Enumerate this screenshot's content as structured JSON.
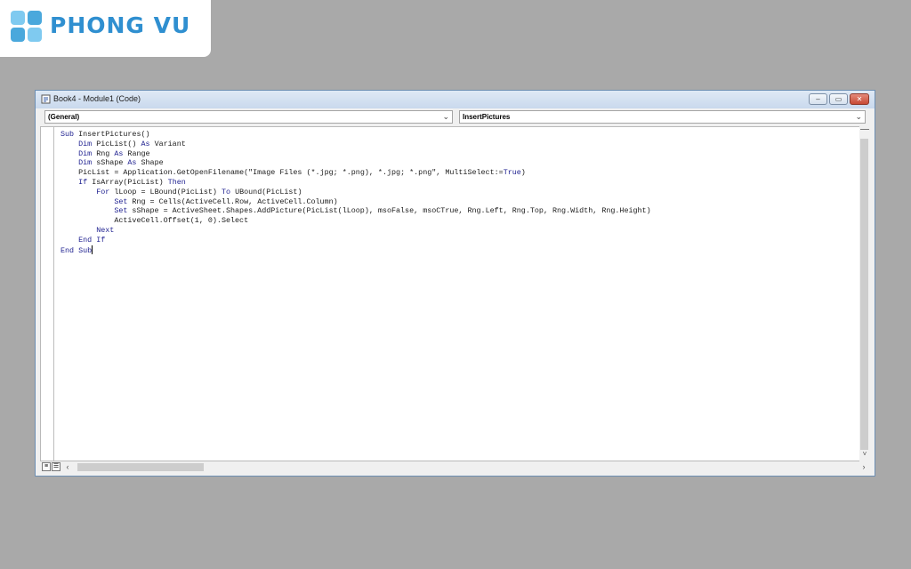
{
  "logo": {
    "text": "PHONG VU"
  },
  "window": {
    "title": "Book4 - Module1 (Code)",
    "buttons": {
      "minimize": "–",
      "restore": "▭",
      "close": "✕"
    }
  },
  "combos": {
    "object": {
      "value": "(General)"
    },
    "procedure": {
      "value": "InsertPictures"
    }
  },
  "code_lines": [
    "Sub InsertPictures()",
    "    Dim PicList() As Variant",
    "    Dim Rng As Range",
    "    Dim sShape As Shape",
    "    PicList = Application.GetOpenFilename(\"Image Files (*.jpg; *.png), *.jpg; *.png\", MultiSelect:=True)",
    "    If IsArray(PicList) Then",
    "        For lLoop = LBound(PicList) To UBound(PicList)",
    "            Set Rng = Cells(ActiveCell.Row, ActiveCell.Column)",
    "            Set sShape = ActiveSheet.Shapes.AddPicture(PicList(lLoop), msoFalse, msoCTrue, Rng.Left, Rng.Top, Rng.Width, Rng.Height)",
    "            ActiveCell.Offset(1, 0).Select",
    "        Next",
    "    End If",
    "End Sub"
  ],
  "keywords": [
    "Sub",
    "Dim",
    "As",
    "If",
    "Then",
    "For",
    "To",
    "Set",
    "Next",
    "End",
    "True"
  ],
  "colors": {
    "keyword": "#1d1f8f",
    "logo": "#2f8fd0"
  }
}
